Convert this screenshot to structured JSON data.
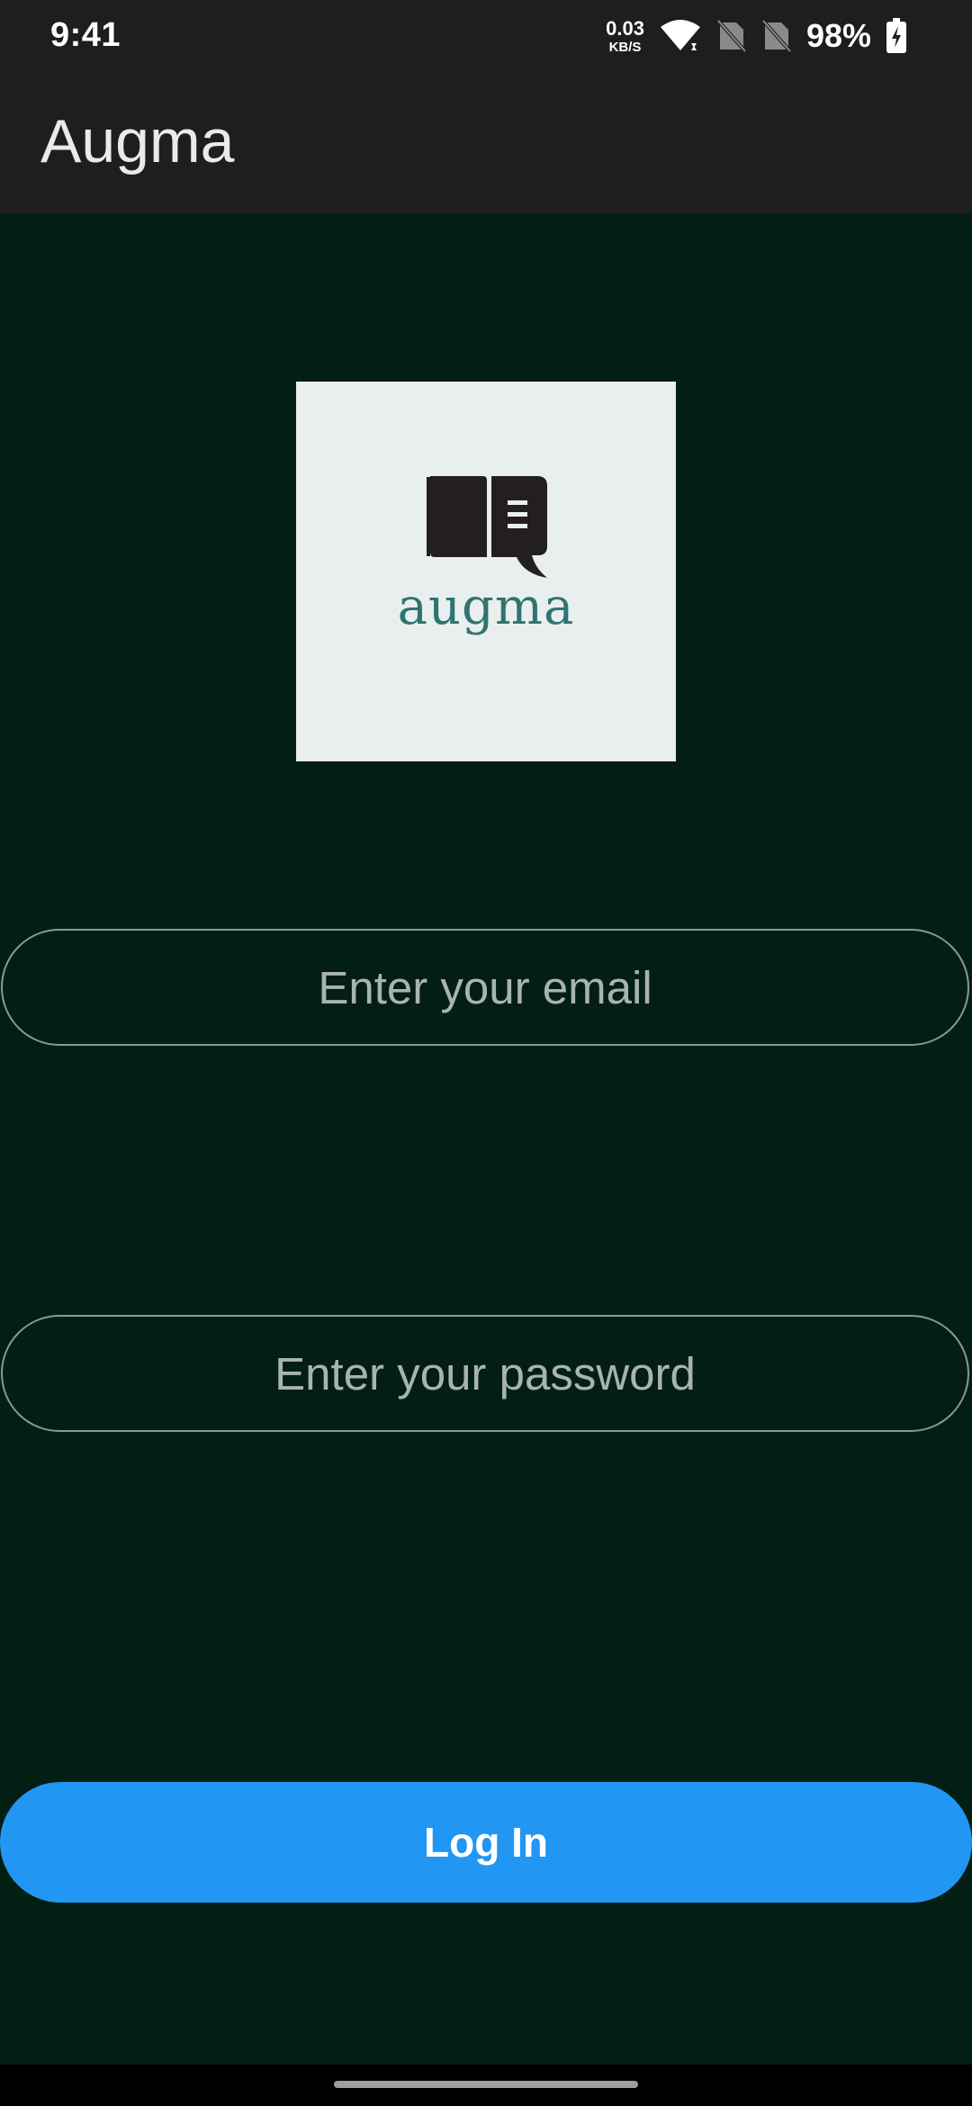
{
  "status_bar": {
    "time": "9:41",
    "net_speed_value": "0.03",
    "net_speed_unit": "KB/S",
    "battery_percent": "98%",
    "icons": [
      "wifi-icon",
      "no-sim-icon",
      "no-sim-icon",
      "battery-charging-icon"
    ]
  },
  "app_bar": {
    "title": "Augma"
  },
  "logo": {
    "wordmark": "augma",
    "icon": "open-book-speech-bubble-icon"
  },
  "form": {
    "email_placeholder": "Enter your email",
    "password_placeholder": "Enter your password",
    "login_label": "Log In"
  },
  "colors": {
    "background": "#031f14",
    "app_bar": "#1d1e20",
    "login_button": "#2196f3",
    "logo_text": "#2f7470"
  }
}
